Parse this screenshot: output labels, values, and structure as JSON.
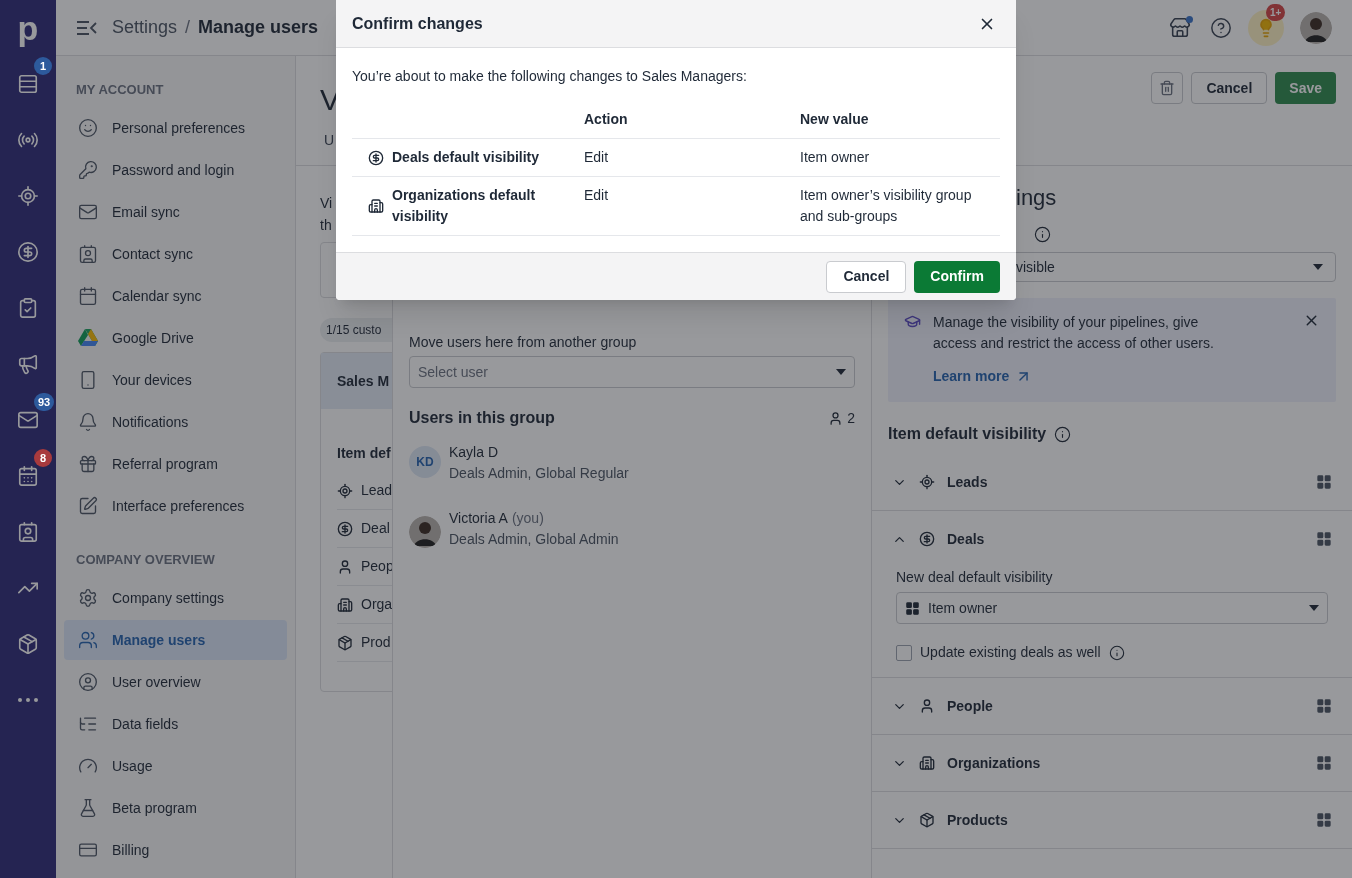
{
  "nav_rail": {
    "logo": "p",
    "items": [
      {
        "kind": "leads-inbox",
        "badge": "1",
        "color": "#2d5a9c"
      },
      {
        "kind": "broadcast"
      },
      {
        "kind": "target"
      },
      {
        "kind": "dollar"
      },
      {
        "kind": "tasks"
      },
      {
        "kind": "campaigns"
      },
      {
        "kind": "mail",
        "badge": "93",
        "color": "#2d5a9c"
      },
      {
        "kind": "calendar",
        "badge": "8",
        "color": "#a83a3d"
      },
      {
        "kind": "contacts"
      },
      {
        "kind": "insights"
      },
      {
        "kind": "products"
      },
      {
        "kind": "more"
      }
    ]
  },
  "top_bar": {
    "breadcrumb_parent": "Settings",
    "breadcrumb_separator": "/",
    "breadcrumb_current": "Manage users",
    "tips_badge": "1+"
  },
  "settings_nav": [
    {
      "heading": "MY ACCOUNT",
      "items": [
        {
          "label": "Personal preferences",
          "kind": "smile",
          "selected": false
        },
        {
          "label": "Password and login",
          "kind": "key",
          "selected": false
        },
        {
          "label": "Email sync",
          "kind": "mail",
          "selected": false
        },
        {
          "label": "Contact sync",
          "kind": "contact",
          "selected": false
        },
        {
          "label": "Calendar sync",
          "kind": "calendar",
          "selected": false
        },
        {
          "label": "Google Drive",
          "kind": "drive",
          "selected": false
        },
        {
          "label": "Your devices",
          "kind": "phone",
          "selected": false
        },
        {
          "label": "Notifications",
          "kind": "bell",
          "selected": false
        },
        {
          "label": "Referral program",
          "kind": "gift",
          "selected": false
        },
        {
          "label": "Interface preferences",
          "kind": "pen",
          "selected": false
        }
      ]
    },
    {
      "heading": "COMPANY OVERVIEW",
      "items": [
        {
          "label": "Company settings",
          "kind": "gear",
          "selected": false
        },
        {
          "label": "Manage users",
          "kind": "users",
          "selected": true
        },
        {
          "label": "User overview",
          "kind": "user-circle",
          "selected": false
        },
        {
          "label": "Data fields",
          "kind": "fields",
          "selected": false
        },
        {
          "label": "Usage",
          "kind": "gauge",
          "selected": false
        },
        {
          "label": "Beta program",
          "kind": "flask",
          "selected": false
        },
        {
          "label": "Billing",
          "kind": "card",
          "selected": false
        }
      ]
    }
  ],
  "page_header": {
    "title": "V",
    "tab": "U",
    "buttons": {
      "cancel": "Cancel",
      "save": "Save"
    }
  },
  "groups_column": {
    "description": [
      "Vi",
      "th"
    ],
    "quota": "1/15 custo",
    "group": {
      "name": "Sales M",
      "section": "Item def",
      "items": [
        {
          "label": "Lead",
          "kind": "leads"
        },
        {
          "label": "Deal",
          "kind": "deals"
        },
        {
          "label": "Peop",
          "kind": "people"
        },
        {
          "label": "Orga",
          "kind": "organizations"
        },
        {
          "label": "Prod",
          "kind": "products"
        }
      ]
    }
  },
  "users_panel": {
    "move_label": "Move users here from another group",
    "select_placeholder": "Select user",
    "heading": "Users in this group",
    "count": "2",
    "users": [
      {
        "kind": "initials",
        "initials": "KD",
        "name": "Kayla D",
        "roles": "Deals Admin, Global Regular"
      },
      {
        "kind": "photo",
        "name": "Victoria A",
        "suffix": "(you)",
        "roles": "Deals Admin, Global Admin"
      }
    ]
  },
  "settings_panel": {
    "heading": "ings",
    "select_value": "visible",
    "tip": {
      "text": "Manage the visibility of your pipelines, give access and restrict the access of other users.",
      "link": "Learn more"
    },
    "section_title": "Item default visibility",
    "entities": [
      {
        "label": "Leads",
        "kind": "leads",
        "expanded": false
      },
      {
        "label": "Deals",
        "kind": "deals",
        "expanded": true,
        "field_label": "New deal default visibility",
        "field_value": "Item owner",
        "checkbox": {
          "label": "Update existing deals as well",
          "checked": false
        }
      },
      {
        "label": "People",
        "kind": "people",
        "expanded": false
      },
      {
        "label": "Organizations",
        "kind": "organizations",
        "expanded": false
      },
      {
        "label": "Products",
        "kind": "products",
        "expanded": false
      }
    ]
  },
  "modal": {
    "title": "Confirm changes",
    "intro": "You’re about to make the following changes to Sales Managers:",
    "columns": [
      "Action",
      "New value"
    ],
    "rows": [
      {
        "kind": "deals",
        "item": "Deals default visibility",
        "action": "Edit",
        "value": "Item owner"
      },
      {
        "kind": "organizations",
        "item": "Organizations default visibility",
        "action": "Edit",
        "value": "Item owner’s visibility group and sub-groups"
      }
    ],
    "cancel": "Cancel",
    "confirm": "Confirm"
  }
}
